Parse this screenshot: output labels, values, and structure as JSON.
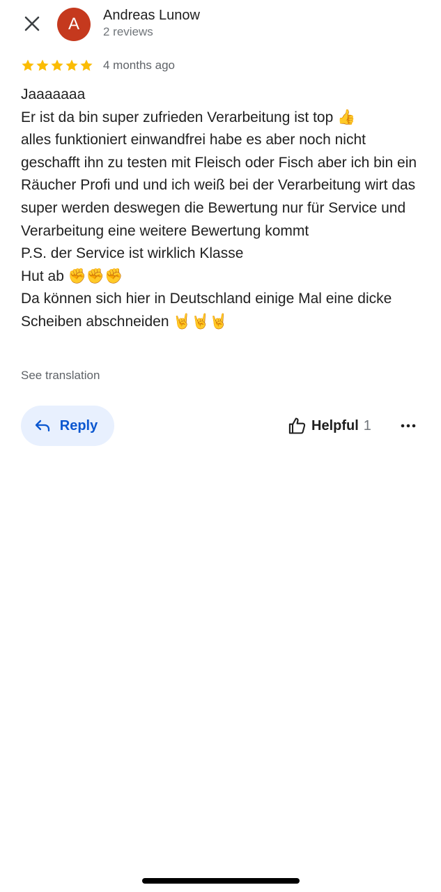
{
  "header": {
    "close_icon": "close-icon",
    "avatar_letter": "A",
    "avatar_color": "#c5391e",
    "author_name": "Andreas Lunow",
    "author_meta": "2 reviews"
  },
  "review": {
    "rating": 5,
    "rating_max": 5,
    "star_color": "#fbbc04",
    "time": "4 months ago",
    "text": "Jaaaaaaa\nEr ist da bin super zufrieden Verarbeitung ist top 👍\nalles funktioniert einwandfrei habe es aber noch nicht geschafft ihn zu testen mit Fleisch oder Fisch aber ich bin ein Räucher Profi und und ich weiß bei der Verarbeitung wirt das super werden deswegen die Bewertung nur für Service und Verarbeitung eine weitere Bewertung kommt\nP.S. der Service ist wirklich Klasse\nHut ab ✊✊✊\nDa können sich hier in Deutschland einige Mal eine dicke Scheiben abschneiden 🤘🤘🤘",
    "see_translation": "See translation"
  },
  "actions": {
    "reply_label": "Reply",
    "reply_icon": "reply-arrow-icon",
    "reply_bg": "#e8f0fe",
    "reply_color": "#0b57d0",
    "helpful_label": "Helpful",
    "helpful_icon": "thumbs-up-icon",
    "helpful_count": "1",
    "more_icon": "more-horizontal-icon"
  }
}
